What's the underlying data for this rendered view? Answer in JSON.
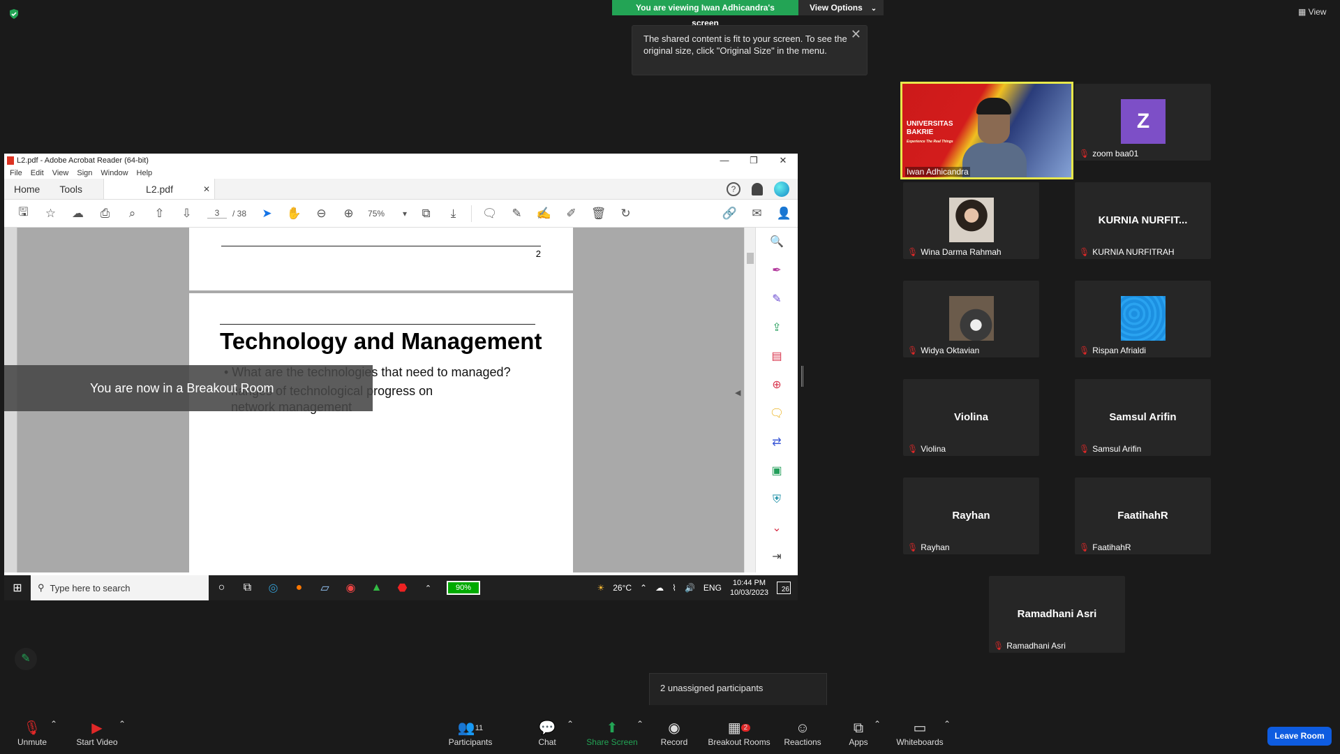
{
  "banner": {
    "viewing": "You are viewing Iwan Adhicandra's screen",
    "view_options": "View Options"
  },
  "tip": {
    "text": "The shared content is fit to your screen. To see the original size, click \"Original Size\" in the menu."
  },
  "top_right": {
    "view_label": "View"
  },
  "acrobat": {
    "title": "L2.pdf - Adobe Acrobat Reader (64-bit)",
    "menu": [
      "File",
      "Edit",
      "View",
      "Sign",
      "Window",
      "Help"
    ],
    "tabs": {
      "home": "Home",
      "tools": "Tools",
      "doc": "L2.pdf"
    },
    "page_current": "3",
    "page_total": "/ 38",
    "zoom": "75%",
    "page_prev_number": "2",
    "slide_title": "Technology and Management",
    "bullet1": "• What are the technologies that need to managed?",
    "bullet2": "hanges of technological progress on",
    "bullet3": "network management"
  },
  "breakout_overlay": "You are now in a Breakout Room",
  "taskbar": {
    "search_placeholder": "Type here to search",
    "battery": "90%",
    "weather": "26°C",
    "lang": "ENG",
    "time": "10:44 PM",
    "date": "10/03/2023",
    "notifications": "26"
  },
  "speaker": {
    "name": "Iwan Adhicandra",
    "bg_line1": "UNIVERSITAS",
    "bg_line2": "BAKRIE",
    "bg_tagline": "Experience The Real Things"
  },
  "participants": [
    {
      "display": "Z",
      "name": "zoom baa01"
    },
    {
      "display": "",
      "name": "Wina Darma Rahmah"
    },
    {
      "display": "KURNIA  NURFIT...",
      "name": "KURNIA NURFITRAH"
    },
    {
      "display": "",
      "name": "Widya Oktavian"
    },
    {
      "display": "",
      "name": "Rispan Afrialdi"
    },
    {
      "display": "Violina",
      "name": "Violina"
    },
    {
      "display": "Samsul Arifin",
      "name": "Samsul Arifin"
    },
    {
      "display": "Rayhan",
      "name": "Rayhan"
    },
    {
      "display": "FaatihahR",
      "name": "FaatihahR"
    },
    {
      "display": "Ramadhani Asri",
      "name": "Ramadhani Asri"
    }
  ],
  "unassigned": "2 unassigned participants",
  "toolbar": {
    "unmute": "Unmute",
    "start_video": "Start Video",
    "participants": "Participants",
    "participants_count": "11",
    "chat": "Chat",
    "share_screen": "Share Screen",
    "record": "Record",
    "breakout_rooms": "Breakout Rooms",
    "breakout_badge": "2",
    "reactions": "Reactions",
    "apps": "Apps",
    "whiteboards": "Whiteboards",
    "leave": "Leave Room"
  },
  "colors": {
    "zoom_green": "#23a455",
    "leave_blue": "#0e5ce0",
    "muted_red": "#e02828",
    "speaker_border": "#e8e84b",
    "z_avatar": "#7d4fc7",
    "tile_blue": "#1c8fe0"
  }
}
